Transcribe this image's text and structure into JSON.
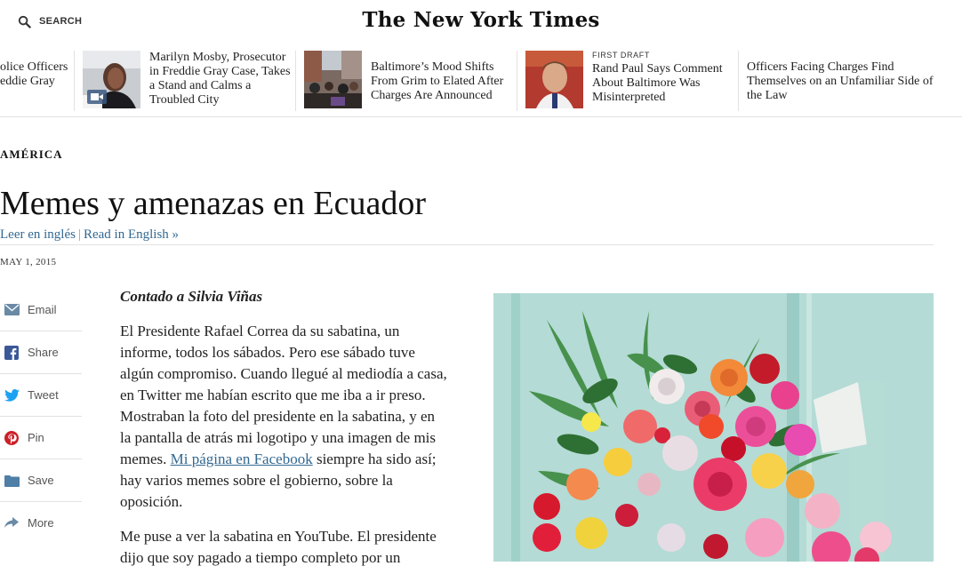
{
  "header": {
    "search_label": "SEARCH",
    "logo_text": "The New York Times"
  },
  "ribbon": {
    "stories": [
      {
        "title": "olice Officers eddie Gray",
        "kicker": ""
      },
      {
        "title": "Marilyn Mosby, Prosecutor in Freddie Gray Case, Takes a Stand and Calms a Troubled City",
        "kicker": ""
      },
      {
        "title": "Baltimore’s Mood Shifts From Grim to Elated After Charges Are Announced",
        "kicker": ""
      },
      {
        "title": "Rand Paul Says Comment About Baltimore Was Misinterpreted",
        "kicker": "FIRST DRAFT"
      },
      {
        "title": "Officers Facing Charges Find Themselves on an Unfamiliar Side of the Law",
        "kicker": ""
      }
    ]
  },
  "article": {
    "section": "AMÉRICA",
    "headline": "Memes y amenazas en Ecuador",
    "lang_spanish": "Leer en inglés",
    "lang_english": "Read in English »",
    "date": "MAY 1, 2015",
    "byline": "Contado a Silvia Viñas",
    "p1_before": "El Presidente Rafael Correa da su sabatina, un informe, todos los sábados. Pero ese sábado tuve algún compromiso. Cuando llegué al mediodía a casa, en Twitter me habían escrito que me iba a ir preso. Mostraban la foto del presidente en la sabatina, y en la pantalla de atrás mi logotipo y una imagen de mis memes.",
    "p1_link": "Mi página en Facebook",
    "p1_after": "siempre ha sido así; hay varios memes sobre el gobierno, sobre la oposición.",
    "p2": "Me puse a ver la sabatina en YouTube. El presidente dijo que soy pagado a tiempo completo por un"
  },
  "share": {
    "email": "Email",
    "share": "Share",
    "tweet": "Tweet",
    "pin": "Pin",
    "save": "Save",
    "more": "More"
  },
  "colors": {
    "link": "#326891",
    "facebook": "#3b5998",
    "twitter": "#1da1f2",
    "pinterest": "#cb2027",
    "email": "#6a8aa6",
    "save": "#4f7fa6"
  },
  "icons": [
    "search-icon",
    "email-icon",
    "facebook-icon",
    "twitter-icon",
    "pinterest-icon",
    "save-icon",
    "share-arrow-icon",
    "video-icon"
  ]
}
